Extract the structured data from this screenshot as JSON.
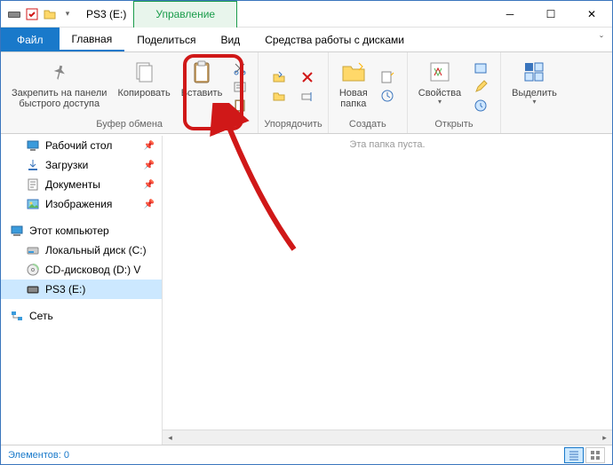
{
  "titlebar": {
    "title": "PS3 (E:)",
    "manage_tab": "Управление"
  },
  "menubar": {
    "file": "Файл",
    "tabs": [
      "Главная",
      "Поделиться",
      "Вид",
      "Средства работы с дисками"
    ]
  },
  "ribbon": {
    "pin": {
      "label": "Закрепить на панели\nбыстрого доступа"
    },
    "copy": {
      "label": "Копировать"
    },
    "paste": {
      "label": "Вставить"
    },
    "clipboard_group": "Буфер обмена",
    "organize_group": "Упорядочить",
    "newfolder": {
      "label": "Новая\nпапка"
    },
    "create_group": "Создать",
    "properties": {
      "label": "Свойства"
    },
    "open_group": "Открыть",
    "select": {
      "label": "Выделить"
    }
  },
  "sidebar": {
    "items": [
      {
        "icon": "desktop",
        "label": "Рабочий стол",
        "pinned": true
      },
      {
        "icon": "download",
        "label": "Загрузки",
        "pinned": true
      },
      {
        "icon": "document",
        "label": "Документы",
        "pinned": true
      },
      {
        "icon": "pictures",
        "label": "Изображения",
        "pinned": true
      }
    ],
    "this_pc": "Этот компьютер",
    "drives": [
      {
        "icon": "hdd",
        "label": "Локальный диск (C:)"
      },
      {
        "icon": "cd",
        "label": "CD-дисковод (D:) V"
      },
      {
        "icon": "usb",
        "label": "PS3 (E:)",
        "selected": true
      }
    ],
    "network": "Сеть"
  },
  "content": {
    "empty_text": "Эта папка пуста."
  },
  "statusbar": {
    "elements": "Элементов: 0"
  }
}
